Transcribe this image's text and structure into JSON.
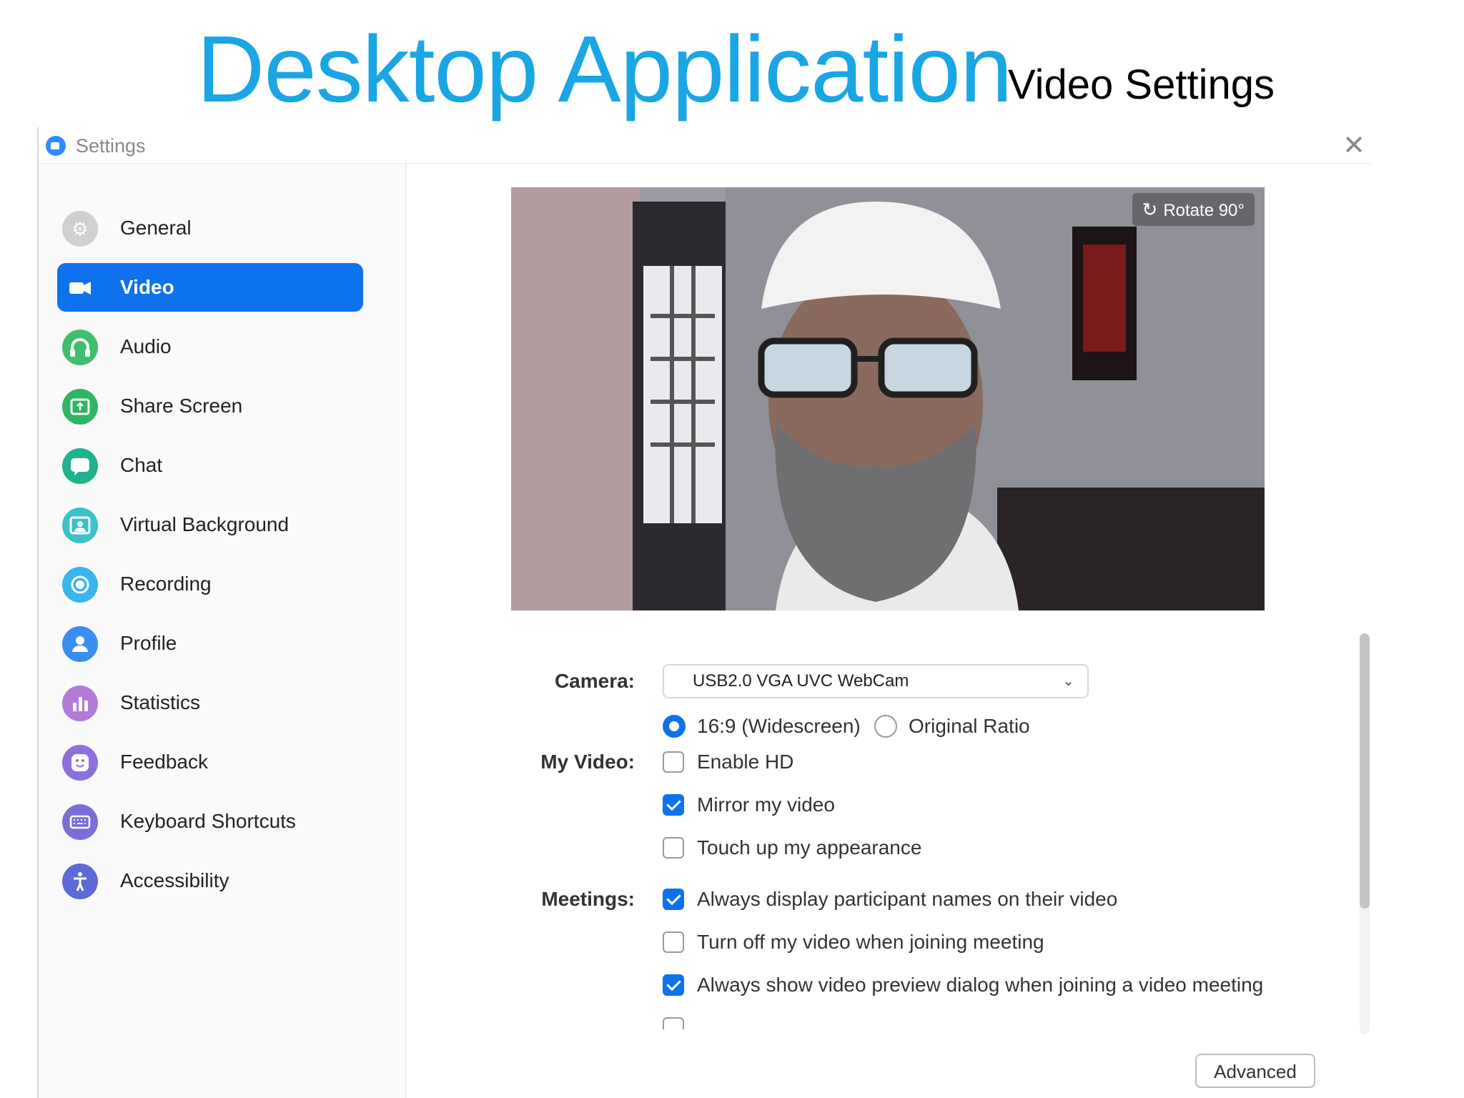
{
  "slide": {
    "title": "Desktop Application",
    "subtitle": "Video Settings"
  },
  "window": {
    "title": "Settings"
  },
  "sidebar": {
    "items": [
      {
        "label": "General",
        "icon": "gear-icon",
        "color": "#c8c8c8",
        "active": false
      },
      {
        "label": "Video",
        "icon": "video-camera-icon",
        "color": "#0e72ed",
        "active": true
      },
      {
        "label": "Audio",
        "icon": "headphones-icon",
        "color": "#3dbf6e",
        "active": false
      },
      {
        "label": "Share Screen",
        "icon": "share-screen-icon",
        "color": "#2fb564",
        "active": false
      },
      {
        "label": "Chat",
        "icon": "chat-icon",
        "color": "#1fb28c",
        "active": false
      },
      {
        "label": "Virtual Background",
        "icon": "person-background-icon",
        "color": "#3cc0c9",
        "active": false
      },
      {
        "label": "Recording",
        "icon": "record-icon",
        "color": "#39b4ef",
        "active": false
      },
      {
        "label": "Profile",
        "icon": "profile-icon",
        "color": "#3a8ef0",
        "active": false
      },
      {
        "label": "Statistics",
        "icon": "bar-chart-icon",
        "color": "#b47ad8",
        "active": false
      },
      {
        "label": "Feedback",
        "icon": "smiley-icon",
        "color": "#8d6fe0",
        "active": false
      },
      {
        "label": "Keyboard Shortcuts",
        "icon": "keyboard-icon",
        "color": "#7a6fd8",
        "active": false
      },
      {
        "label": "Accessibility",
        "icon": "accessibility-icon",
        "color": "#5d6ad8",
        "active": false
      }
    ]
  },
  "preview": {
    "rotate_label": "Rotate 90°"
  },
  "settings": {
    "camera_label": "Camera:",
    "camera_value": "USB2.0 VGA UVC WebCam",
    "ratio_options": [
      {
        "label": "16:9 (Widescreen)",
        "selected": true
      },
      {
        "label": "Original Ratio",
        "selected": false
      }
    ],
    "my_video_label": "My Video:",
    "my_video_options": [
      {
        "label": "Enable HD",
        "checked": false
      },
      {
        "label": "Mirror my video",
        "checked": true
      },
      {
        "label": "Touch up my appearance",
        "checked": false
      }
    ],
    "meetings_label": "Meetings:",
    "meetings_options": [
      {
        "label": "Always display participant names on their video",
        "checked": true
      },
      {
        "label": "Turn off my video when joining meeting",
        "checked": false
      },
      {
        "label": "Always show video preview dialog when joining a video meeting",
        "checked": true
      }
    ],
    "advanced_label": "Advanced"
  },
  "colors": {
    "accent": "#0e72ed",
    "title_blue": "#1aa6e4"
  }
}
